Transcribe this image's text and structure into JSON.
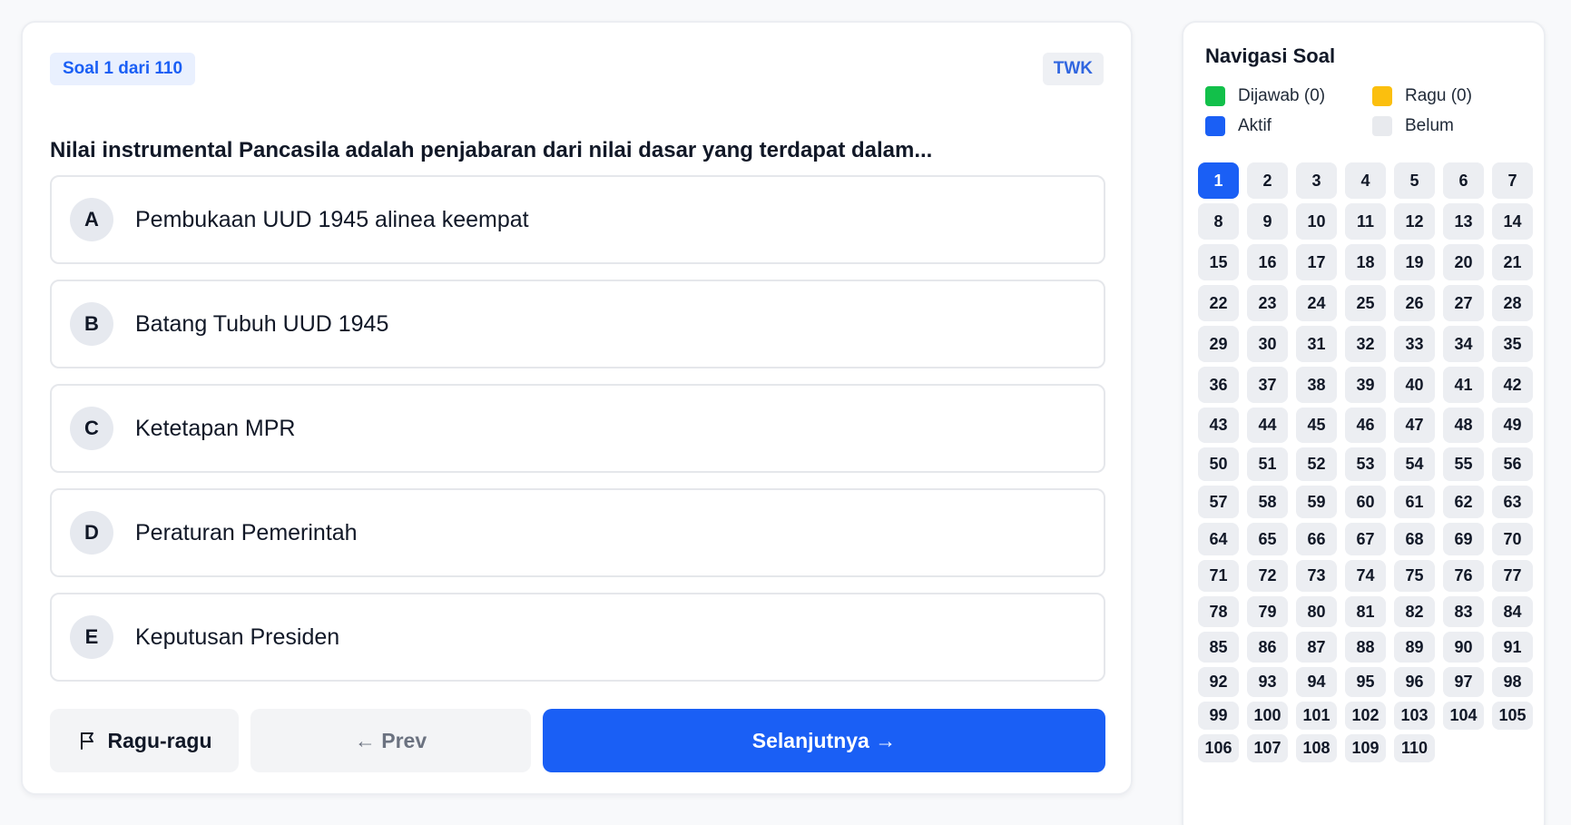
{
  "question": {
    "number_label": "Soal 1 dari 110",
    "category": "TWK",
    "text": "Nilai instrumental Pancasila adalah penjabaran dari nilai dasar yang terdapat dalam...",
    "options": [
      {
        "letter": "A",
        "text": "Pembukaan UUD 1945 alinea keempat"
      },
      {
        "letter": "B",
        "text": "Batang Tubuh UUD 1945"
      },
      {
        "letter": "C",
        "text": "Ketetapan MPR"
      },
      {
        "letter": "D",
        "text": "Peraturan Pemerintah"
      },
      {
        "letter": "E",
        "text": "Keputusan Presiden"
      }
    ]
  },
  "actions": {
    "ragu_label": "Ragu-ragu",
    "prev_label": "← Prev",
    "next_label": "Selanjutnya →"
  },
  "navigation": {
    "title": "Navigasi Soal",
    "legend": {
      "answered": "Dijawab (0)",
      "doubt": "Ragu (0)",
      "active": "Aktif",
      "unanswered": "Belum"
    },
    "total_questions": 110,
    "active_question": 1
  },
  "colors": {
    "primary": "#1a5ff5",
    "answered": "#12c04a",
    "doubt": "#fbbf0e",
    "unanswered": "#e8eaee"
  }
}
